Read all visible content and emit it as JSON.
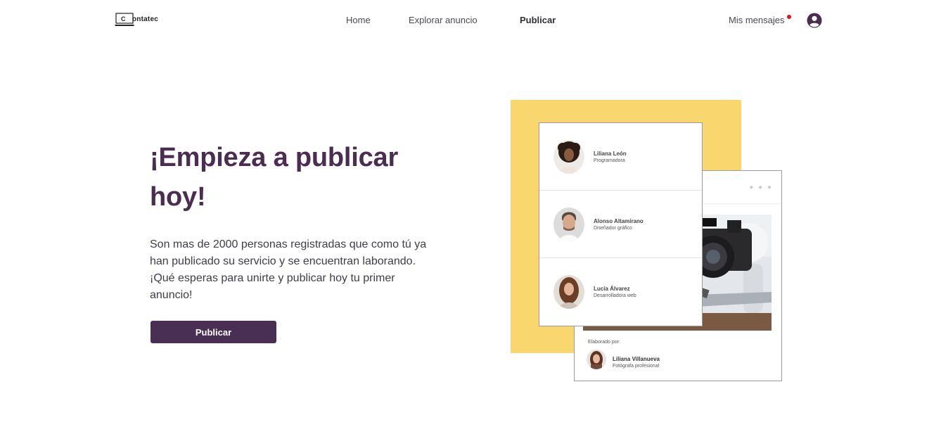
{
  "header": {
    "logo_letter": "C",
    "logo_text": "ontatec",
    "nav": {
      "home": "Home",
      "explore": "Explorar anuncio",
      "publish": "Publicar",
      "messages": "Mis mensajes"
    },
    "user_icon": "user-circle-icon",
    "notification_color": "#e2141c"
  },
  "hero": {
    "title": "¡Empieza a publicar hoy!",
    "description": "Son mas de 2000 personas registradas que como tú ya han publicado su servicio y se encuentran laborando. ¡Qué esperas para unirte y publicar hoy tu primer anuncio!",
    "button_label": "Publicar",
    "button_color": "#4a2f55",
    "title_color": "#4a2d50"
  },
  "illustration": {
    "accent_color": "#fad66e",
    "people": [
      {
        "name": "Liliana León",
        "role": "Programadora"
      },
      {
        "name": "Alonso Altamirano",
        "role": "Diseñador gráfico"
      },
      {
        "name": "Lucía Álvarez",
        "role": "Desarrolladora web"
      }
    ],
    "post": {
      "dots": "● ● ●",
      "by_label": "Elaborado por:",
      "author_name": "Liliana Villanueva",
      "author_role": "Fotógrafa profesional"
    }
  }
}
